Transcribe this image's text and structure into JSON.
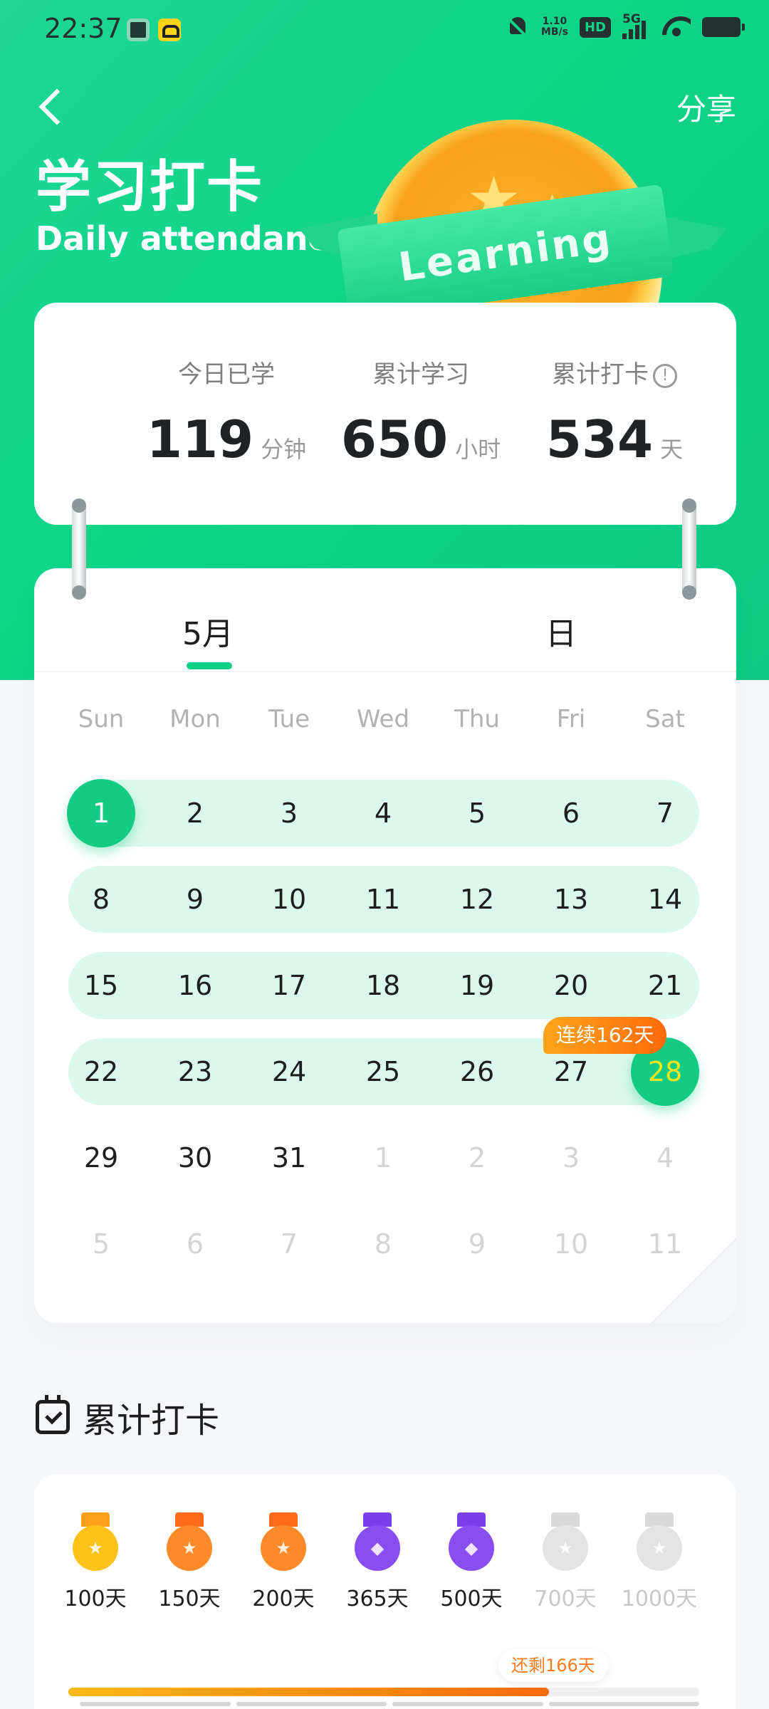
{
  "status_bar": {
    "time": "22:37",
    "net_speed_value": "1.10",
    "net_speed_unit": "MB/s",
    "hd_label": "HD",
    "network_label": "5G"
  },
  "header": {
    "back_icon": "chevron-left-icon",
    "share_label": "分享",
    "title": "学习打卡",
    "subtitle": "Daily attendance",
    "medal_ribbon_text": "Learning"
  },
  "stats": [
    {
      "label": "今日已学",
      "value": "119",
      "unit": "分钟"
    },
    {
      "label": "累计学习",
      "value": "650",
      "unit": "小时"
    },
    {
      "label": "累计打卡",
      "value": "534",
      "unit": "天",
      "info_icon": "!"
    }
  ],
  "calendar": {
    "tabs": [
      {
        "label": "5月",
        "selected": true
      },
      {
        "label": "日",
        "selected": false
      }
    ],
    "weekdays": [
      "Sun",
      "Mon",
      "Tue",
      "Wed",
      "Thu",
      "Fri",
      "Sat"
    ],
    "weeks": [
      {
        "days": [
          "1",
          "2",
          "3",
          "4",
          "5",
          "6",
          "7"
        ],
        "checked": true
      },
      {
        "days": [
          "8",
          "9",
          "10",
          "11",
          "12",
          "13",
          "14"
        ],
        "checked": true
      },
      {
        "days": [
          "15",
          "16",
          "17",
          "18",
          "19",
          "20",
          "21"
        ],
        "checked": true
      },
      {
        "days": [
          "22",
          "23",
          "24",
          "25",
          "26",
          "27",
          "28"
        ],
        "checked": true
      },
      {
        "days": [
          "29",
          "30",
          "31",
          "1",
          "2",
          "3",
          "4"
        ],
        "checked": false,
        "muted_from": 3
      },
      {
        "days": [
          "5",
          "6",
          "7",
          "8",
          "9",
          "10",
          "11"
        ],
        "checked": false,
        "muted_from": 0
      }
    ],
    "highlight_start": "1",
    "today": "28",
    "streak_badge": "连续162天"
  },
  "cumulative": {
    "section_title": "累计打卡",
    "milestones": [
      {
        "label": "100天",
        "achieved": true,
        "color": "#ffc21a",
        "strap": "#ff9f1a",
        "shape": "star"
      },
      {
        "label": "150天",
        "achieved": true,
        "color": "#ff8a2a",
        "strap": "#ff6b1a",
        "shape": "star"
      },
      {
        "label": "200天",
        "achieved": true,
        "color": "#ff8a2a",
        "strap": "#ff6b1a",
        "shape": "star"
      },
      {
        "label": "365天",
        "achieved": true,
        "color": "#8a4df2",
        "strap": "#7a3ee8",
        "shape": "diamond"
      },
      {
        "label": "500天",
        "achieved": true,
        "color": "#8a4df2",
        "strap": "#7a3ee8",
        "shape": "diamond"
      },
      {
        "label": "700天",
        "achieved": false,
        "color": "#e3e3e3",
        "strap": "#d8d8d8",
        "shape": "star"
      },
      {
        "label": "1000天",
        "achieved": false,
        "color": "#e3e3e3",
        "strap": "#d8d8d8",
        "shape": "star"
      }
    ],
    "remaining_label": "还剩166天",
    "progress_fraction": 0.762
  },
  "colors": {
    "brand_green": "#10cf87",
    "band_green": "#dbf8ec",
    "streak_orange": "#ff7a1a"
  }
}
